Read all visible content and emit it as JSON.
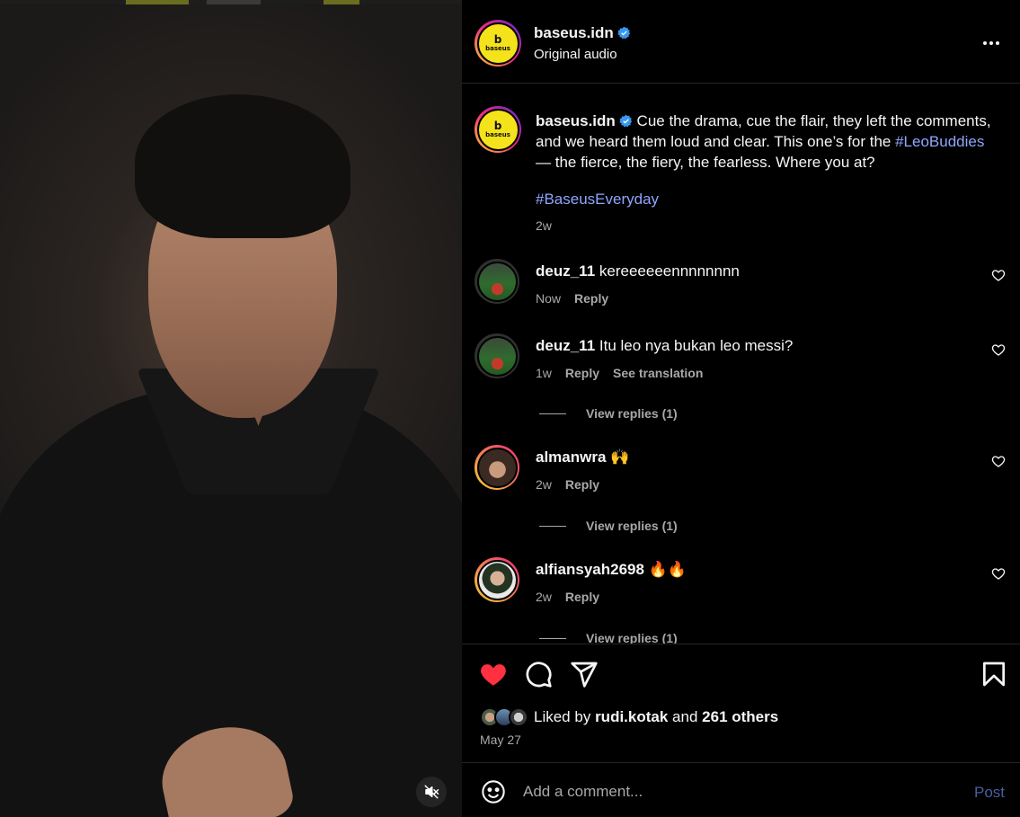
{
  "post": {
    "username": "baseus.idn",
    "audio": "Original audio",
    "avatar_text": {
      "mark": "b",
      "word": "baseus"
    },
    "caption": {
      "text_before": "Cue the drama, cue the flair, they left the comments, and we heard them loud and clear. This one’s for the ",
      "hashtag_inline": "#LeoBuddies",
      "text_after": " — the fierce, the fiery, the fearless. Where you at?",
      "hashtag": "#BaseusEveryday",
      "time": "2w"
    }
  },
  "comments": [
    {
      "username": "deuz_11",
      "text": "kereeeeeennnnnnnn",
      "time": "Now",
      "reply": "Reply",
      "see_translation": "",
      "view_replies": ""
    },
    {
      "username": "deuz_11",
      "text": "Itu leo nya bukan leo messi?",
      "time": "1w",
      "reply": "Reply",
      "see_translation": "See translation",
      "view_replies": "View replies (1)"
    },
    {
      "username": "almanwra",
      "text": "🙌",
      "time": "2w",
      "reply": "Reply",
      "see_translation": "",
      "view_replies": "View replies (1)"
    },
    {
      "username": "alfiansyah2698",
      "text": "🔥🔥",
      "time": "2w",
      "reply": "Reply",
      "see_translation": "",
      "view_replies": "View replies (1)"
    }
  ],
  "likes": {
    "prefix": "Liked by",
    "user": "rudi.kotak",
    "middle": "and",
    "others": "261 others",
    "date": "May 27"
  },
  "add_comment": {
    "placeholder": "Add a comment...",
    "post_label": "Post"
  },
  "colors": {
    "accent_link": "#8fa6ff",
    "like_red": "#ff3040",
    "verified_blue": "#3897f0",
    "baseus_yellow": "#f4e21b"
  },
  "icons": {
    "more": "more-options-icon",
    "like": "heart-filled-icon",
    "comment": "comment-icon",
    "share": "paper-plane-icon",
    "save": "bookmark-icon",
    "emoji": "smiley-icon",
    "mute": "speaker-muted-icon",
    "verified": "verified-badge-icon"
  }
}
